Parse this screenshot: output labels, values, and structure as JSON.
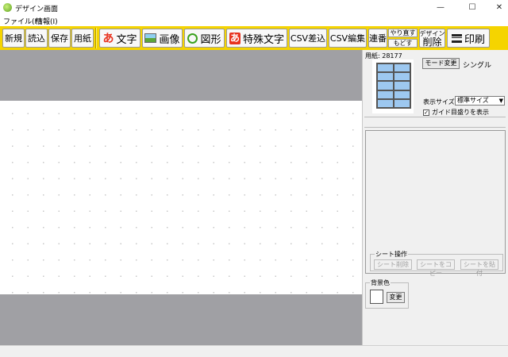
{
  "window": {
    "title": "デザイン画面",
    "minimize": "—",
    "maximize": "☐",
    "close": "✕"
  },
  "menu": {
    "items": [
      {
        "label": "ファイル(F)"
      },
      {
        "label": "情報(I)"
      }
    ]
  },
  "toolbar": {
    "new": "新規",
    "open": "読込",
    "save": "保存",
    "paper": "用紙",
    "text": "文字",
    "text_icon": "あ",
    "image": "画像",
    "shape": "図形",
    "special_text": "特殊文字",
    "special_icon": "あ",
    "csv_merge": "CSV差込",
    "csv_edit": "CSV編集",
    "serial": "連番",
    "redo": "やり直す",
    "undo": "もどす",
    "delete_top": "デザイン",
    "delete_bottom": "削除",
    "print": "印刷"
  },
  "panel": {
    "paper_label": "用紙: 28177",
    "mode_button": "モード変更",
    "mode_value": "シングル",
    "display_size_label": "表示サイズ",
    "display_size_value": "標準サイズ",
    "guide_label": "ガイド目盛りを表示",
    "guide_checked": "✓",
    "sheet_ops": {
      "legend": "シート操作",
      "delete": "シート削除",
      "copy": "シートをコピー",
      "paste": "シートを貼付"
    },
    "background": {
      "legend": "背景色",
      "change": "変更",
      "color": "#ffffff"
    }
  },
  "colors": {
    "toolbar": "#f5d400",
    "canvas_bg": "#a0a0a4",
    "thumb_cell": "#9dc8f0"
  }
}
